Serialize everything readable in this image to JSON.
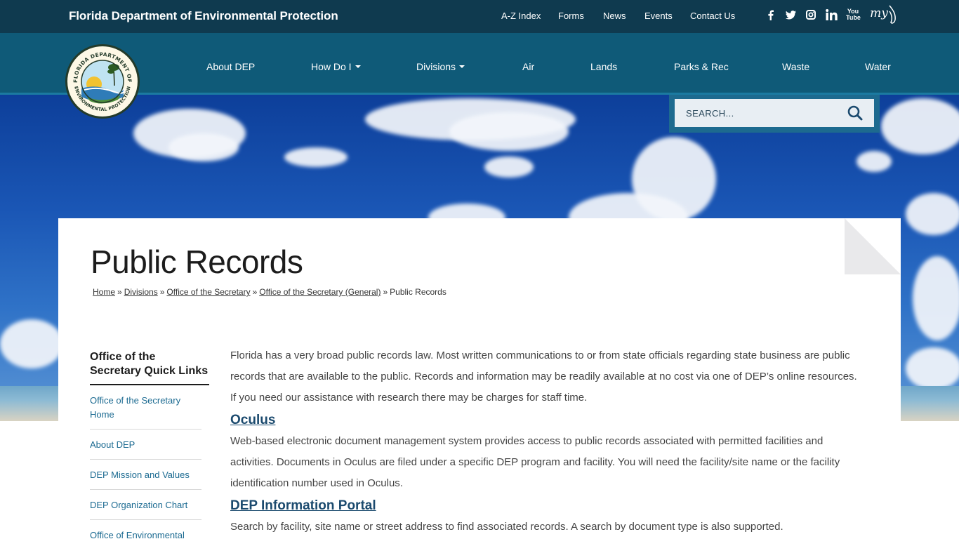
{
  "header": {
    "site_title": "Florida Department of Environmental Protection",
    "utility_links": [
      "A-Z Index",
      "Forms",
      "News",
      "Events",
      "Contact Us"
    ],
    "social_icons": [
      "facebook-icon",
      "twitter-icon",
      "instagram-icon",
      "linkedin-icon",
      "youtube-icon",
      "myflorida-icon"
    ],
    "youtube_text": "You Tube",
    "myflorida_text": "my"
  },
  "nav": {
    "items": [
      {
        "label": "About DEP",
        "dropdown": false
      },
      {
        "label": "How Do I",
        "dropdown": true
      },
      {
        "label": "Divisions",
        "dropdown": true
      },
      {
        "label": "Air",
        "dropdown": false
      },
      {
        "label": "Lands",
        "dropdown": false
      },
      {
        "label": "Parks & Rec",
        "dropdown": false
      },
      {
        "label": "Waste",
        "dropdown": false
      },
      {
        "label": "Water",
        "dropdown": false
      }
    ]
  },
  "logo": {
    "text_top": "FLORIDA DEPARTMENT OF",
    "text_bottom": "ENVIRONMENTAL PROTECTION"
  },
  "search": {
    "placeholder": "SEARCH..."
  },
  "page": {
    "title": "Public Records",
    "breadcrumb": [
      "Home",
      "Divisions",
      "Office of the Secretary",
      "Office of the Secretary (General)"
    ],
    "breadcrumb_current": "Public Records",
    "breadcrumb_sep": "»"
  },
  "sidebar": {
    "title": "Office of the Secretary Quick Links",
    "items": [
      "Office of the Secretary Home",
      "About DEP",
      "DEP Mission and Values",
      "DEP Organization Chart",
      "Office of Environmental"
    ]
  },
  "content": {
    "intro": "Florida has a very broad public records law. Most written communications to or from state officials regarding state business are public records that are available to the public. Records and information may be readily available at no cost via one of DEP’s online resources. If you need our assistance with research there may be charges for staff time.",
    "sections": [
      {
        "heading": "Oculus",
        "body": "Web-based electronic document management system provides access to public records associated with permitted facilities and activities. Documents in Oculus are filed under a specific DEP program and facility. You will need the facility/site name or the facility identification number used in Oculus."
      },
      {
        "heading": "DEP Information Portal",
        "body": "Search by facility, site name or street address to find associated records. A search by document type is also supported."
      }
    ]
  },
  "colors": {
    "topbar": "#0f3a4f",
    "navbar": "#0f5a78",
    "link": "#1b6a91",
    "heading_link": "#1b4a6e"
  }
}
